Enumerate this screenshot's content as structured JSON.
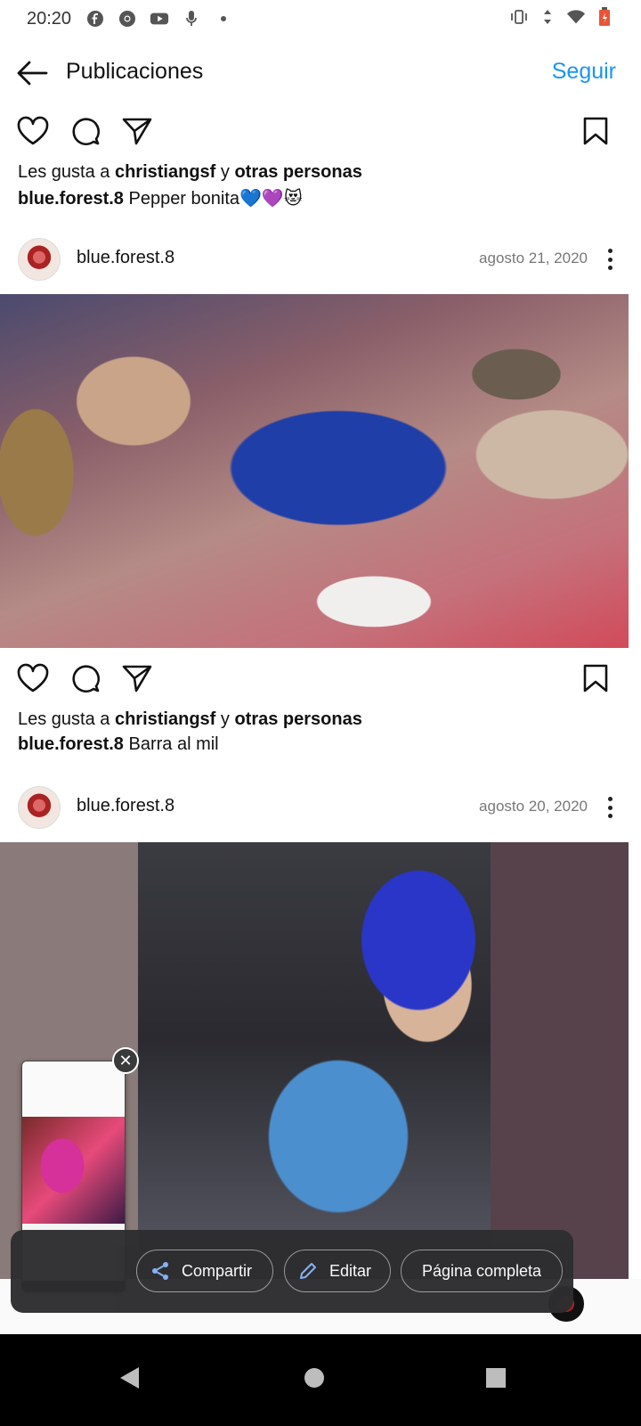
{
  "status_bar": {
    "time": "20:20"
  },
  "header": {
    "title": "Publicaciones",
    "follow_label": "Seguir"
  },
  "posts": [
    {
      "likes_prefix": "Les gusta a ",
      "liker": "christiangsf",
      "likes_mid": " y ",
      "likes_others": "otras personas",
      "caption_user": "blue.forest.8",
      "caption_text": " Pepper bonita💙💜😻"
    },
    {
      "username": "blue.forest.8",
      "date": "agosto 21, 2020",
      "likes_prefix": "Les gusta a ",
      "liker": "christiangsf",
      "likes_mid": " y ",
      "likes_others": "otras personas",
      "caption_user": "blue.forest.8",
      "caption_text": " Barra al mil"
    },
    {
      "username": "blue.forest.8",
      "date": "agosto 20, 2020"
    }
  ],
  "share_sheet": {
    "share_label": "Compartir",
    "edit_label": "Editar",
    "full_page_label": "Página completa",
    "close_symbol": "✕"
  },
  "colors": {
    "accent": "#1a95f0",
    "panel": "#2d2d30"
  }
}
